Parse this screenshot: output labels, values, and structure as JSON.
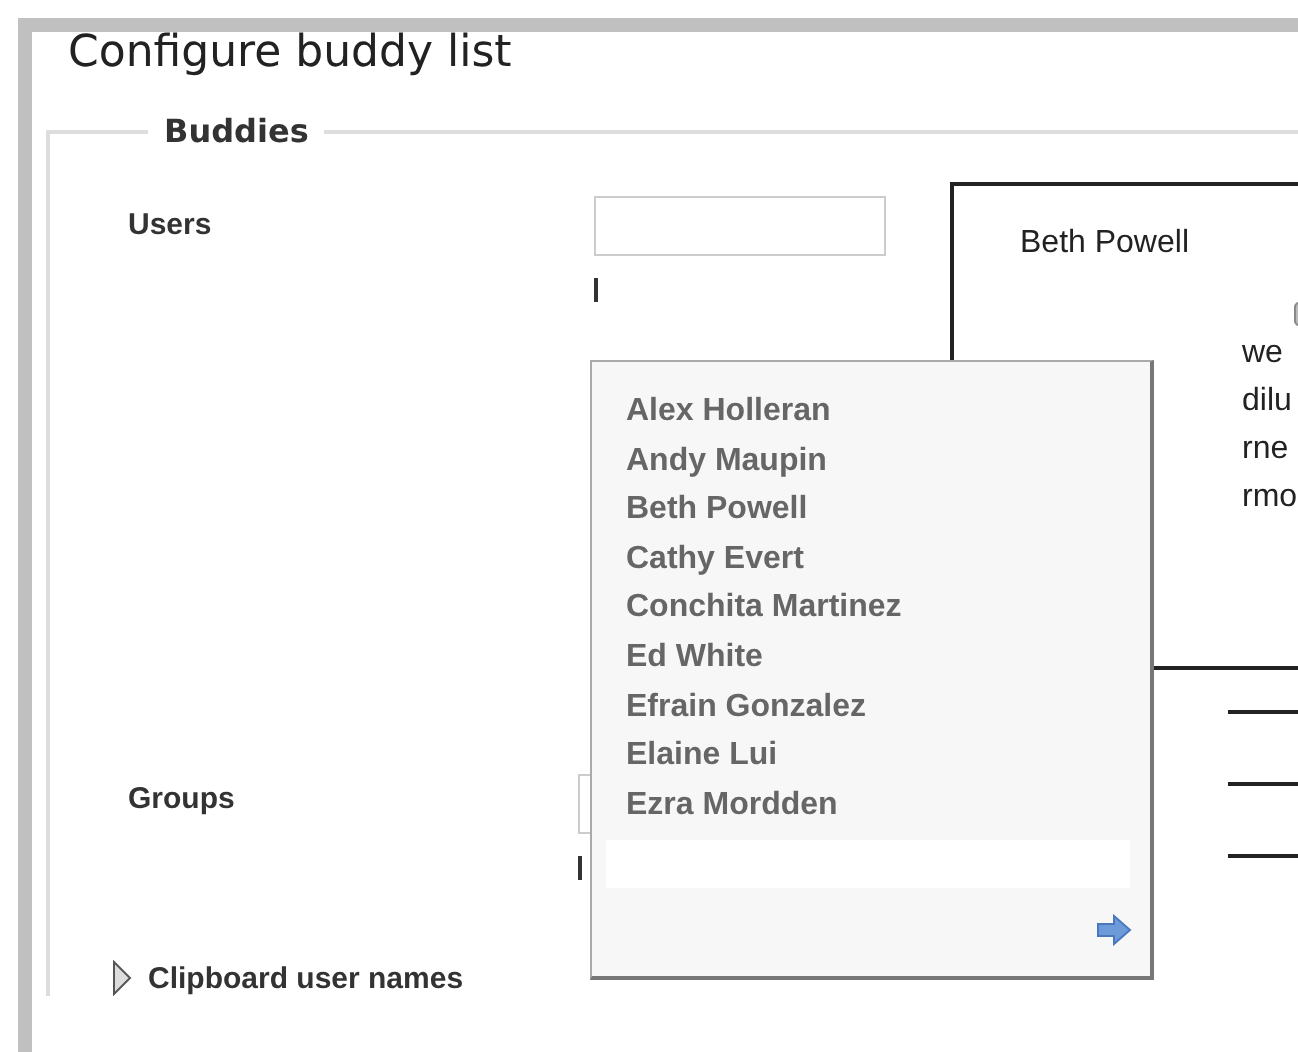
{
  "page": {
    "title": "Configure buddy list"
  },
  "fieldset": {
    "legend": "Buddies"
  },
  "users": {
    "label": "Users"
  },
  "selected_users": {
    "items": [
      "Beth Powell"
    ],
    "fragments": [
      "we",
      "dilu",
      "rne",
      "rmo"
    ]
  },
  "suggestions": {
    "items": [
      "Alex Holleran",
      "Andy Maupin",
      "Beth Powell",
      "Cathy Evert",
      "Conchita Martinez",
      "Ed White",
      "Efrain Gonzalez",
      "Elaine Lui",
      "Ezra Mordden"
    ]
  },
  "groups": {
    "label": "Groups"
  },
  "clipboard": {
    "label": "Clipboard user names",
    "expanded": false
  }
}
